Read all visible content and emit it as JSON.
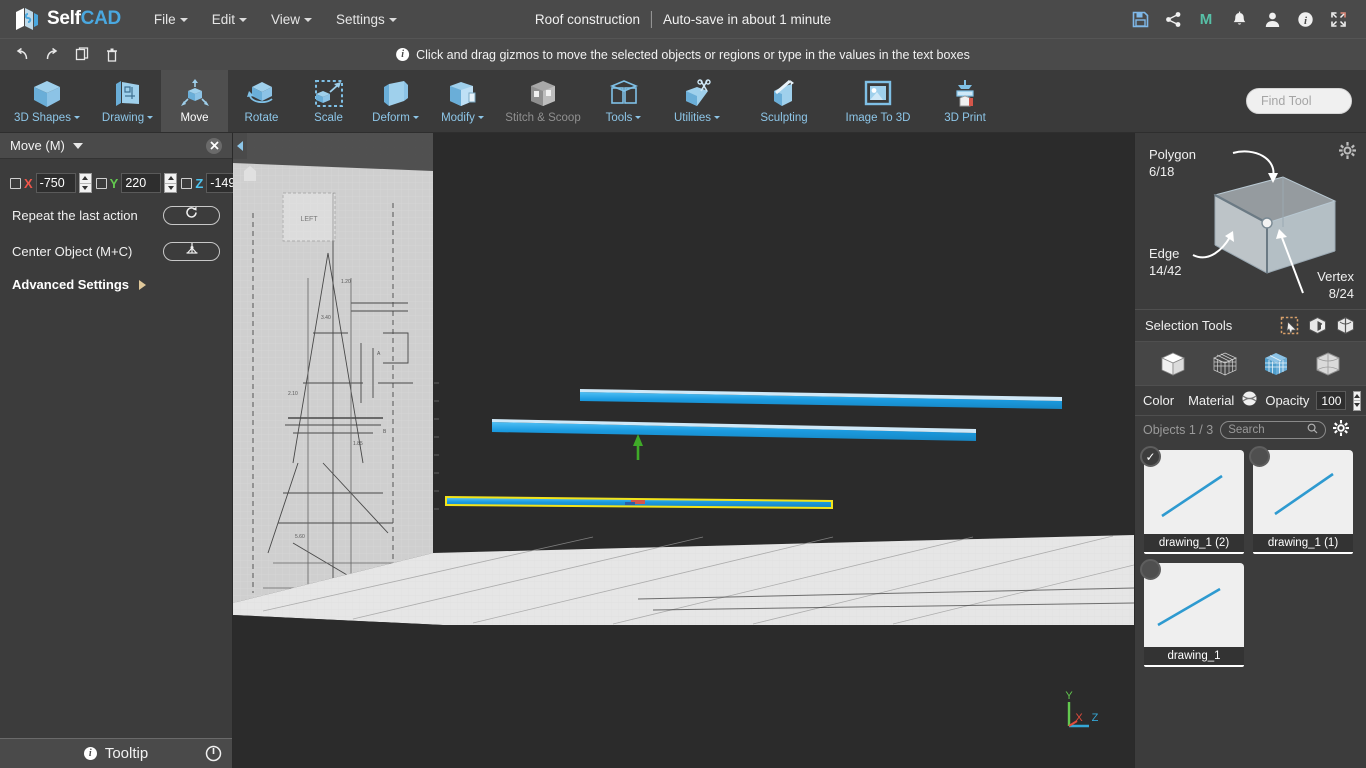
{
  "app": {
    "logo_text_1": "Self",
    "logo_text_2": "CAD",
    "project_title": "Roof construction",
    "autosave_status": "Auto-save in about 1 minute"
  },
  "menu": {
    "items": [
      {
        "label": "File",
        "has_caret": true
      },
      {
        "label": "Edit",
        "has_caret": true
      },
      {
        "label": "View",
        "has_caret": true
      },
      {
        "label": "Settings",
        "has_caret": true
      }
    ]
  },
  "topright_icons": [
    {
      "name": "save-icon",
      "title": "Save"
    },
    {
      "name": "share-icon",
      "title": "Share"
    },
    {
      "name": "mirror-m-icon",
      "title": "M"
    },
    {
      "name": "notifications-bell-icon",
      "title": "Notifications"
    },
    {
      "name": "user-account-icon",
      "title": "Account"
    },
    {
      "name": "info-icon",
      "title": "Info"
    },
    {
      "name": "fullscreen-icon",
      "title": "Fullscreen"
    }
  ],
  "subbar": {
    "buttons": [
      {
        "name": "undo-icon",
        "title": "Undo"
      },
      {
        "name": "redo-icon",
        "title": "Redo"
      },
      {
        "name": "copy-icon",
        "title": "Copy"
      },
      {
        "name": "delete-icon",
        "title": "Delete"
      }
    ],
    "notice": "Click and drag gizmos to move the selected objects or regions or type in the values in the text boxes"
  },
  "toolbar": {
    "tools": [
      {
        "label": "3D Shapes",
        "caret": true,
        "active": false,
        "disabled": false
      },
      {
        "label": "Drawing",
        "caret": true,
        "active": false,
        "disabled": false
      },
      {
        "label": "Move",
        "caret": false,
        "active": true,
        "disabled": false
      },
      {
        "label": "Rotate",
        "caret": false,
        "active": false,
        "disabled": false
      },
      {
        "label": "Scale",
        "caret": false,
        "active": false,
        "disabled": false
      },
      {
        "label": "Deform",
        "caret": true,
        "active": false,
        "disabled": false
      },
      {
        "label": "Modify",
        "caret": true,
        "active": false,
        "disabled": false
      },
      {
        "label": "Stitch & Scoop",
        "caret": false,
        "active": false,
        "disabled": true
      },
      {
        "label": "Tools",
        "caret": true,
        "active": false,
        "disabled": false
      },
      {
        "label": "Utilities",
        "caret": true,
        "active": false,
        "disabled": false
      },
      {
        "label": "Sculpting",
        "caret": false,
        "active": false,
        "disabled": false
      },
      {
        "label": "Image To 3D",
        "caret": false,
        "active": false,
        "disabled": false
      },
      {
        "label": "3D Print",
        "caret": false,
        "active": false,
        "disabled": false
      }
    ],
    "find_tool_placeholder": "Find Tool"
  },
  "left_panel": {
    "title": "Move (M)",
    "close_label": "✖",
    "axes": [
      {
        "axis": "X",
        "value": "-750",
        "checked": false,
        "color": "#f0564a"
      },
      {
        "axis": "Y",
        "value": "220",
        "checked": false,
        "color": "#63c94f"
      },
      {
        "axis": "Z",
        "value": "-149",
        "checked": false,
        "color": "#4cc4f0"
      }
    ],
    "rows": [
      {
        "label": "Repeat the last action",
        "button": "repeat-last-action-button",
        "icon": "refresh-icon"
      },
      {
        "label": "Center Object (M+C)",
        "button": "center-object-button",
        "icon": "center-object-icon"
      }
    ],
    "advanced_settings": "Advanced Settings",
    "tooltip_bar": "Tooltip"
  },
  "viewport": {
    "reference_label": "LEFT",
    "axis_gizmo": {
      "x": "X",
      "y": "Y",
      "z": "Z",
      "x_color": "#e24b3c",
      "y_color": "#63c94f",
      "z_color": "#35a7d6"
    },
    "objects_in_scene": 3,
    "selected_object_outline_color": "#f2e31b",
    "beam_color": "#1b9be0"
  },
  "right_panel": {
    "stats": {
      "polygon_label": "Polygon",
      "polygon_value": "6/18",
      "edge_label": "Edge",
      "edge_value": "14/42",
      "vertex_label": "Vertex",
      "vertex_value": "8/24"
    },
    "selection_tools_label": "Selection Tools",
    "selection_icons": [
      {
        "name": "rectangle-select-icon"
      },
      {
        "name": "polygon-select-icon"
      },
      {
        "name": "loop-select-icon"
      }
    ],
    "view_modes": [
      {
        "name": "solid-view-icon"
      },
      {
        "name": "wireframe-view-icon"
      },
      {
        "name": "shaded-wireframe-view-icon"
      },
      {
        "name": "transparent-view-icon"
      }
    ],
    "material_row": {
      "color_label": "Color",
      "color_value": "#29c0f0",
      "material_label": "Material",
      "opacity_label": "Opacity",
      "opacity_value": "100"
    },
    "objects_header": "Objects 1 / 3",
    "search_placeholder": "Search",
    "objects": [
      {
        "name": "drawing_1 (2)",
        "selected": true
      },
      {
        "name": "drawing_1 (1)",
        "selected": false
      },
      {
        "name": "drawing_1",
        "selected": false
      }
    ]
  }
}
